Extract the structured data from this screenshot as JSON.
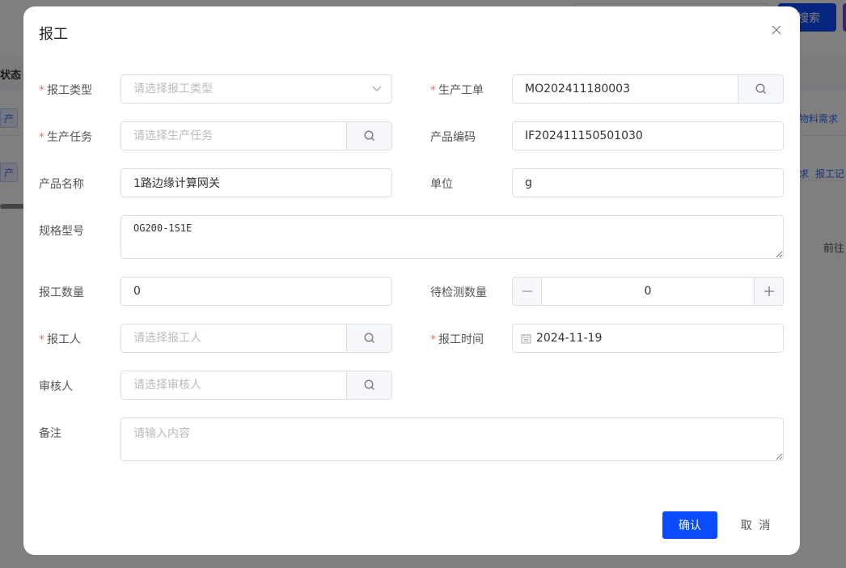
{
  "background": {
    "search_label": "搜索",
    "status_header": "状态",
    "row_tag": "产",
    "row1_link": "物料需求",
    "row2_links": [
      "求",
      "报工记"
    ],
    "goto_label": "前往"
  },
  "dialog": {
    "title": "报工",
    "fields": {
      "report_type": {
        "label": "报工类型",
        "placeholder": "请选择报工类型"
      },
      "work_order": {
        "label": "生产工单",
        "value": "MO202411180003"
      },
      "production_task": {
        "label": "生产任务",
        "placeholder": "请选择生产任务"
      },
      "product_code": {
        "label": "产品编码",
        "value": "IF202411150501030"
      },
      "product_name": {
        "label": "产品名称",
        "value": "1路边缘计算网关"
      },
      "unit": {
        "label": "单位",
        "value": "g"
      },
      "spec": {
        "label": "规格型号",
        "value": "OG200-1S1E"
      },
      "report_qty": {
        "label": "报工数量",
        "value": "0"
      },
      "pending_qty": {
        "label": "待检测数量",
        "value": "0"
      },
      "reporter": {
        "label": "报工人",
        "placeholder": "请选择报工人"
      },
      "report_time": {
        "label": "报工时间",
        "value": "2024-11-19"
      },
      "reviewer": {
        "label": "审核人",
        "placeholder": "请选择审核人"
      },
      "remark": {
        "label": "备注",
        "placeholder": "请输入内容"
      }
    },
    "buttons": {
      "confirm": "确认",
      "cancel": "取 消"
    }
  },
  "colors": {
    "primary": "#0a4bff",
    "required": "#f56c6c"
  }
}
